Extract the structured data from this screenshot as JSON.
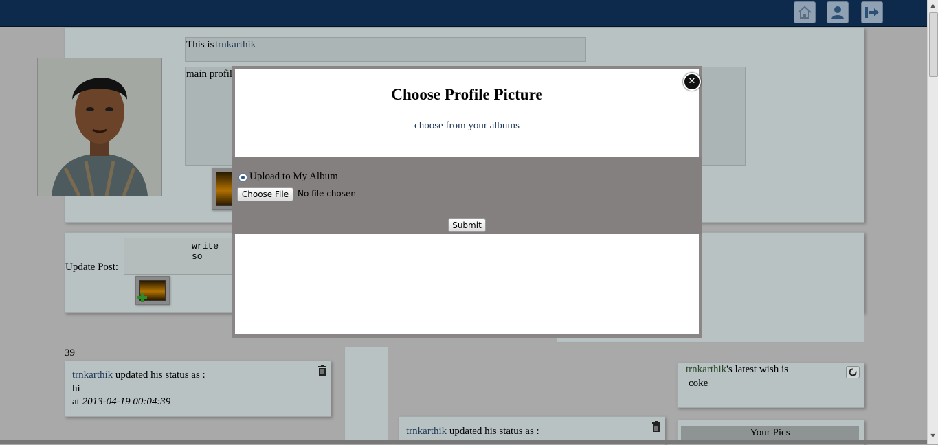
{
  "profile": {
    "intro_prefix": "This is",
    "username": "trnkarthik",
    "main_profile_label": "main profile",
    "post_label": "Update Post:",
    "post_placeholder": "write so"
  },
  "feed": {
    "count": "39",
    "status1": {
      "user": "trnkarthik",
      "text": "updated his status as :",
      "content": "hi",
      "at_label": "at",
      "timestamp": "2013-04-19 00:04:39"
    },
    "status2": {
      "user": "trnkarthik",
      "text": "updated his status as :"
    }
  },
  "wish": {
    "user": "trnkarthik",
    "text": "'s latest wish is",
    "content": "coke"
  },
  "your_pics": {
    "title": "Your Pics"
  },
  "modal": {
    "title": "Choose Profile Picture",
    "albums_link": "choose from your albums",
    "radio_label": "Upload to My Album",
    "file_button": "Choose File",
    "file_status": "No file chosen",
    "submit": "Submit",
    "close_glyph": "✕"
  },
  "nav": {
    "icons": [
      "home-icon",
      "user-icon",
      "logout-icon"
    ]
  },
  "colors": {
    "topbar": "#0d2a4c",
    "overlay": "#a9a9a9",
    "modal_mid": "#858080",
    "link": "#213a5a"
  }
}
